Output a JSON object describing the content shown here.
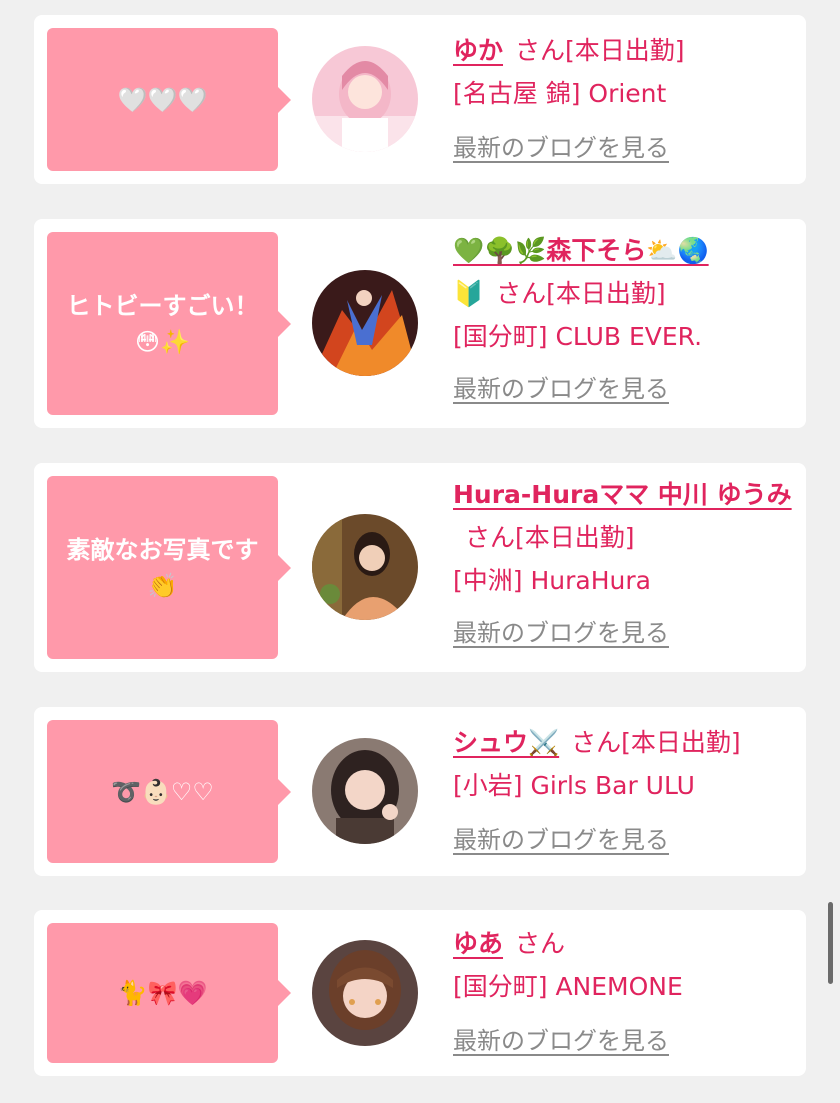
{
  "colors": {
    "background": "#f0f0f0",
    "card": "#ffffff",
    "bubble": "#ff99aa",
    "accent": "#e0245e",
    "link_muted": "#8a8a8a"
  },
  "cards": [
    {
      "comment": "🤍🤍🤍",
      "name": "ゆか",
      "honorific": "さん",
      "status": "[本日出勤]",
      "shop": "[名古屋 錦] Orient",
      "blog_link": "最新のブログを見る"
    },
    {
      "comment": "ヒトビーすごい！\n😳✨",
      "name": "💚🌳🌿森下そら⛅🌏",
      "name_trailing_icon": "🔰",
      "honorific": "さん",
      "status": "[本日出勤]",
      "shop": "[国分町] CLUB EVER.",
      "blog_link": "最新のブログを見る"
    },
    {
      "comment": "素敵なお写真です\n👏",
      "name": "Hura-Huraママ 中川 ゆうみ",
      "honorific": "さん",
      "status": "[本日出勤]",
      "shop": "[中洲] HuraHura",
      "blog_link": "最新のブログを見る"
    },
    {
      "comment": "➰👶🏻♡♡",
      "name": "シュウ⚔️",
      "honorific": "さん",
      "status": "[本日出勤]",
      "shop": "[小岩] Girls Bar ULU",
      "blog_link": "最新のブログを見る"
    },
    {
      "comment": "🐈🎀💗",
      "name": "ゆあ",
      "honorific": "さん",
      "status": "",
      "shop": "[国分町] ANEMONE",
      "blog_link": "最新のブログを見る"
    }
  ]
}
